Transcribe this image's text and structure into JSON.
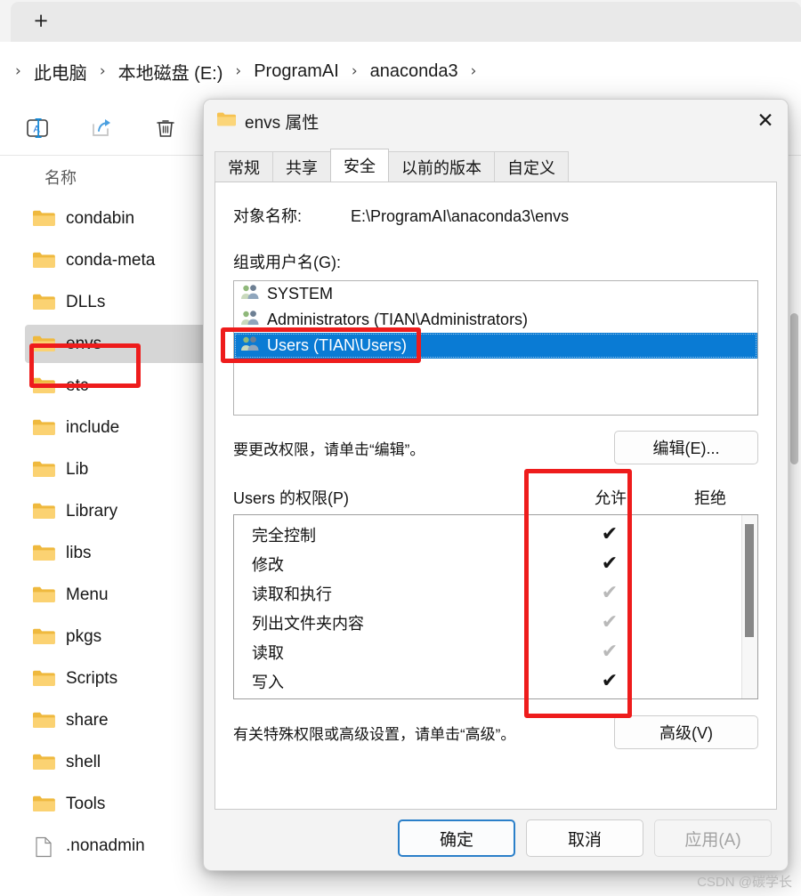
{
  "explorer": {
    "tab_bar": {
      "new_tab_label": "+"
    },
    "breadcrumb": {
      "leading_sep": "›",
      "items": [
        {
          "label": "此电脑"
        },
        {
          "label": "本地磁盘 (E:)"
        },
        {
          "label": "ProgramAI"
        },
        {
          "label": "anaconda3"
        }
      ],
      "separator": "›",
      "trailing_sep": "›"
    },
    "toolbar": [
      {
        "name": "rename-icon",
        "label": "重命名"
      },
      {
        "name": "share-icon",
        "label": "共享"
      },
      {
        "name": "delete-icon",
        "label": "删除"
      }
    ],
    "column_header": {
      "name": "名称"
    },
    "files": [
      {
        "label": "condabin",
        "type": "folder",
        "selected": false
      },
      {
        "label": "conda-meta",
        "type": "folder",
        "selected": false
      },
      {
        "label": "DLLs",
        "type": "folder",
        "selected": false
      },
      {
        "label": "envs",
        "type": "folder",
        "selected": true
      },
      {
        "label": "etc",
        "type": "folder",
        "selected": false
      },
      {
        "label": "include",
        "type": "folder",
        "selected": false
      },
      {
        "label": "Lib",
        "type": "folder",
        "selected": false
      },
      {
        "label": "Library",
        "type": "folder",
        "selected": false
      },
      {
        "label": "libs",
        "type": "folder",
        "selected": false
      },
      {
        "label": "Menu",
        "type": "folder",
        "selected": false
      },
      {
        "label": "pkgs",
        "type": "folder",
        "selected": false
      },
      {
        "label": "Scripts",
        "type": "folder",
        "selected": false
      },
      {
        "label": "share",
        "type": "folder",
        "selected": false
      },
      {
        "label": "shell",
        "type": "folder",
        "selected": false
      },
      {
        "label": "Tools",
        "type": "folder",
        "selected": false
      },
      {
        "label": ".nonadmin",
        "type": "file",
        "selected": false
      }
    ]
  },
  "dialog": {
    "title": "envs 属性",
    "close_label": "✕",
    "tabs": [
      {
        "label": "常规",
        "active": false
      },
      {
        "label": "共享",
        "active": false
      },
      {
        "label": "安全",
        "active": true
      },
      {
        "label": "以前的版本",
        "active": false
      },
      {
        "label": "自定义",
        "active": false
      }
    ],
    "object_name_label": "对象名称:",
    "object_name_value": "E:\\ProgramAI\\anaconda3\\envs",
    "group_label": "组或用户名(G):",
    "group_items": [
      {
        "label": "SYSTEM",
        "selected": false
      },
      {
        "label": "Administrators (TIAN\\Administrators)",
        "selected": false
      },
      {
        "label": "Users (TIAN\\Users)",
        "selected": true
      }
    ],
    "edit_hint": "要更改权限，请单击“编辑”。",
    "edit_button": "编辑(E)...",
    "permissions_title": "Users 的权限(P)",
    "allow_column": "允许",
    "deny_column": "拒绝",
    "permissions": [
      {
        "label": "完全控制",
        "allow": "checked",
        "deny": "none"
      },
      {
        "label": "修改",
        "allow": "checked",
        "deny": "none"
      },
      {
        "label": "读取和执行",
        "allow": "checked-dim",
        "deny": "none"
      },
      {
        "label": "列出文件夹内容",
        "allow": "checked-dim",
        "deny": "none"
      },
      {
        "label": "读取",
        "allow": "checked-dim",
        "deny": "none"
      },
      {
        "label": "写入",
        "allow": "checked",
        "deny": "none"
      }
    ],
    "advanced_hint": "有关特殊权限或高级设置，请单击“高级”。",
    "advanced_button": "高级(V)",
    "footer": {
      "ok": "确定",
      "cancel": "取消",
      "apply": "应用(A)"
    }
  },
  "annotations": {
    "accent_color": "#ee1c1c",
    "boxes": [
      {
        "name": "annot-envs-folder"
      },
      {
        "name": "annot-users-entry"
      },
      {
        "name": "annot-allow-column"
      }
    ]
  },
  "watermark": "CSDN @碳学长"
}
